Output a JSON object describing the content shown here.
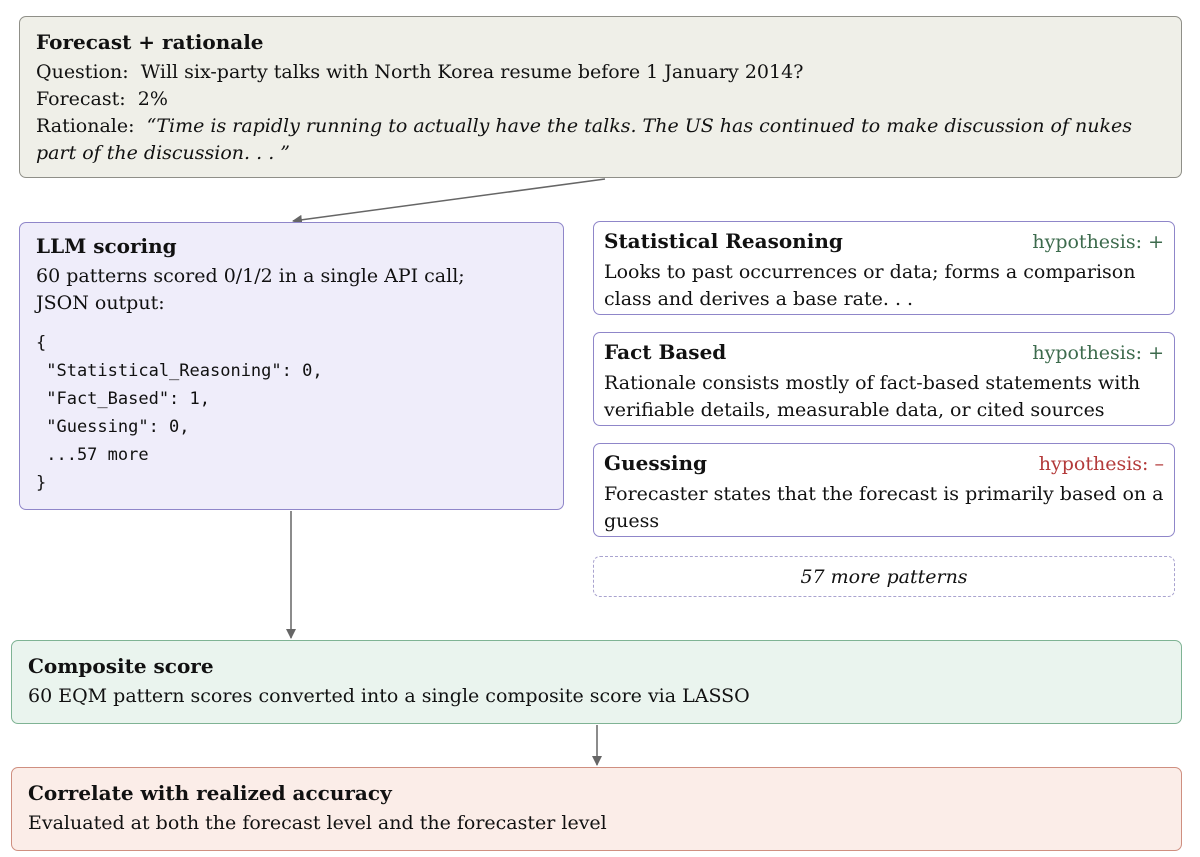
{
  "forecast": {
    "title": "Forecast + rationale",
    "question_label": "Question:",
    "question": "Will six-party talks with North Korea resume before 1 January 2014?",
    "forecast_label": "Forecast:",
    "forecast_value": "2%",
    "rationale_label": "Rationale:",
    "rationale": "“Time is rapidly running to actually have the talks. The US has continued to make discussion of nukes part of the discussion. . . ”"
  },
  "llm": {
    "title": "LLM scoring",
    "description": "60 patterns scored 0/1/2 in a single API call; JSON output:",
    "code_lines": [
      "{",
      " \"Statistical_Reasoning\": 0,",
      " \"Fact_Based\": 1,",
      " \"Guessing\": 0,",
      " ...57 more",
      "}"
    ]
  },
  "patterns": [
    {
      "title": "Statistical Reasoning",
      "hypothesis": "hypothesis: +",
      "description": "Looks to past occurrences or data; forms a comparison class and derives a base rate. . ."
    },
    {
      "title": "Fact Based",
      "hypothesis": "hypothesis: +",
      "description": "Rationale consists mostly of fact-based statements with verifiable details, measurable data, or cited sources"
    },
    {
      "title": "Guessing",
      "hypothesis": "hypothesis: –",
      "description": "Forecaster states that the forecast is primarily based on a guess"
    }
  ],
  "more_patterns": "57 more patterns",
  "composite": {
    "title": "Composite score",
    "description": "60 EQM pattern scores converted into a single composite score via LASSO"
  },
  "correlate": {
    "title": "Correlate with realized accuracy",
    "description": "Evaluated at both the forecast level and the forecaster level"
  },
  "colors": {
    "hypothesis_positive": "#3d6b4d",
    "hypothesis_negative": "#b33a3a",
    "forecast_fill": "#efefe8",
    "llm_fill": "#efedfa",
    "composite_fill": "#eaf4ee",
    "correlate_fill": "#fbede8"
  }
}
